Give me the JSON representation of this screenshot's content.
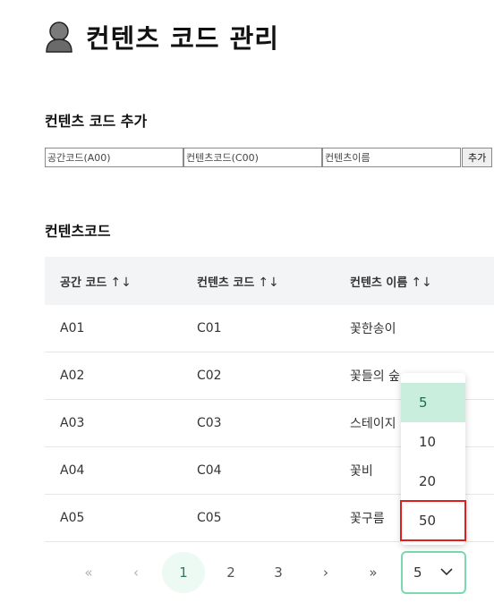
{
  "header": {
    "title": "컨텐츠 코드 관리",
    "avatar_icon": "person-avatar-icon"
  },
  "add_section": {
    "title": "컨텐츠 코드 추가",
    "fields": [
      {
        "placeholder": "공간코드(A00)"
      },
      {
        "placeholder": "컨텐츠코드(C00)"
      },
      {
        "placeholder": "컨텐츠이름"
      }
    ],
    "submit_label": "추가"
  },
  "list_section": {
    "title": "컨텐츠코드",
    "columns": [
      "공간 코드",
      "컨텐츠 코드",
      "컨텐츠 이름"
    ],
    "sort_icon": "↑↓",
    "rows": [
      [
        "A01",
        "C01",
        "꽃한송이"
      ],
      [
        "A02",
        "C02",
        "꽃들의 숲"
      ],
      [
        "A03",
        "C03",
        "스테이지"
      ],
      [
        "A04",
        "C04",
        "꽃비"
      ],
      [
        "A05",
        "C05",
        "꽃구름"
      ]
    ]
  },
  "pagination": {
    "first": "«",
    "prev": "‹",
    "pages": [
      "1",
      "2",
      "3"
    ],
    "current_page": "1",
    "next": "›",
    "last": "»",
    "page_size": "5",
    "page_size_options": [
      "5",
      "10",
      "20",
      "50"
    ],
    "highlighted_option": "50"
  },
  "colors": {
    "accent_green": "#7ad9ae",
    "selected_option_bg": "#c9eedd",
    "highlight_red": "#e11d1d"
  }
}
